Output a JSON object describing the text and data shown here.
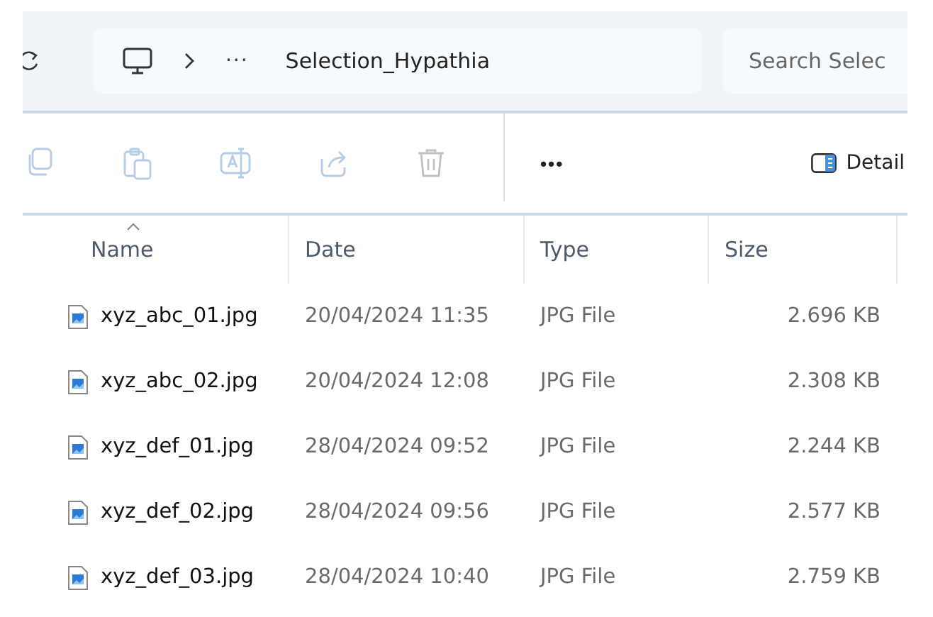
{
  "address_bar": {
    "breadcrumb_overflow": "···",
    "current_folder": "Selection_Hypathia"
  },
  "search": {
    "placeholder": "Search Selec"
  },
  "toolbar": {
    "actions": [
      {
        "kind": "copy",
        "disabled": true
      },
      {
        "kind": "paste",
        "disabled": true
      },
      {
        "kind": "rename",
        "disabled": true
      },
      {
        "kind": "share",
        "disabled": true
      },
      {
        "kind": "delete",
        "disabled": true
      }
    ],
    "more": "•••",
    "details": "Detail"
  },
  "table": {
    "columns": [
      {
        "label": "Name",
        "sorted": true
      },
      {
        "label": "Date",
        "sorted": false
      },
      {
        "label": "Type",
        "sorted": false
      },
      {
        "label": "Size",
        "sorted": false
      }
    ],
    "rows": [
      {
        "name": "xyz_abc_01.jpg",
        "date": "20/04/2024 11:35",
        "type": "JPG File",
        "size": "2.696 KB"
      },
      {
        "name": "xyz_abc_02.jpg",
        "date": "20/04/2024 12:08",
        "type": "JPG File",
        "size": "2.308 KB"
      },
      {
        "name": "xyz_def_01.jpg",
        "date": "28/04/2024 09:52",
        "type": "JPG File",
        "size": "2.244 KB"
      },
      {
        "name": "xyz_def_02.jpg",
        "date": "28/04/2024 09:56",
        "type": "JPG File",
        "size": "2.577 KB"
      },
      {
        "name": "xyz_def_03.jpg",
        "date": "28/04/2024 10:40",
        "type": "JPG File",
        "size": "2.759 KB"
      }
    ]
  }
}
